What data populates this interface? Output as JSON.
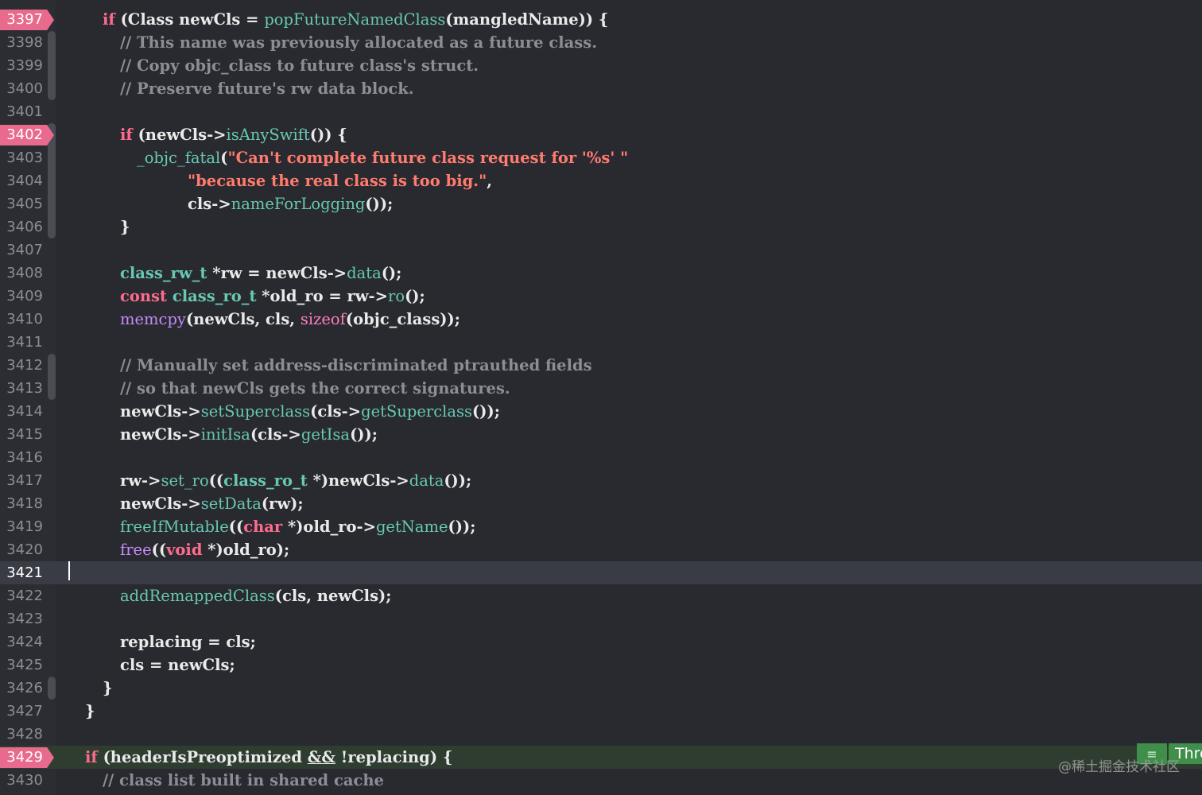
{
  "editor": {
    "current_line": "3421",
    "lines": [
      {
        "num": "3397",
        "indent": 129,
        "bp": true,
        "segs": [
          [
            "kw",
            "if"
          ],
          [
            "pl",
            " (Class newCls = "
          ],
          [
            "fn",
            "popFutureNamedClass"
          ],
          [
            "pl",
            "(mangledName)) {"
          ]
        ]
      },
      {
        "num": "3398",
        "indent": 151,
        "segs": [
          [
            "cm",
            "// This name was previously allocated as a future class."
          ]
        ]
      },
      {
        "num": "3399",
        "indent": 151,
        "segs": [
          [
            "cm",
            "// Copy objc_class to future class's struct."
          ]
        ]
      },
      {
        "num": "3400",
        "indent": 151,
        "segs": [
          [
            "cm",
            "// Preserve future's rw data block."
          ]
        ]
      },
      {
        "num": "3401",
        "indent": 151,
        "segs": []
      },
      {
        "num": "3402",
        "indent": 151,
        "bp": true,
        "segs": [
          [
            "kw",
            "if"
          ],
          [
            "pl",
            " (newCls->"
          ],
          [
            "fn",
            "isAnySwift"
          ],
          [
            "pl",
            "()) {"
          ]
        ]
      },
      {
        "num": "3403",
        "indent": 172,
        "segs": [
          [
            "fn",
            "_objc_fatal"
          ],
          [
            "pl",
            "("
          ],
          [
            "str",
            "\"Can't complete future class request for '%s' \""
          ]
        ]
      },
      {
        "num": "3404",
        "indent": 236,
        "segs": [
          [
            "str",
            "\"because the real class is too big.\""
          ],
          [
            "pl",
            ","
          ]
        ]
      },
      {
        "num": "3405",
        "indent": 236,
        "segs": [
          [
            "pl",
            "cls->"
          ],
          [
            "fn",
            "nameForLogging"
          ],
          [
            "pl",
            "());"
          ]
        ]
      },
      {
        "num": "3406",
        "indent": 151,
        "segs": [
          [
            "pl",
            "}"
          ]
        ]
      },
      {
        "num": "3407",
        "indent": 151,
        "segs": []
      },
      {
        "num": "3408",
        "indent": 151,
        "segs": [
          [
            "tp",
            "class_rw_t"
          ],
          [
            "pl",
            " *rw = newCls->"
          ],
          [
            "fn",
            "data"
          ],
          [
            "pl",
            "();"
          ]
        ]
      },
      {
        "num": "3409",
        "indent": 151,
        "segs": [
          [
            "kw",
            "const"
          ],
          [
            "pl",
            " "
          ],
          [
            "tp",
            "class_ro_t"
          ],
          [
            "pl",
            " *old_ro = rw->"
          ],
          [
            "fn",
            "ro"
          ],
          [
            "pl",
            "();"
          ]
        ]
      },
      {
        "num": "3410",
        "indent": 151,
        "segs": [
          [
            "lib",
            "memcpy"
          ],
          [
            "pl",
            "(newCls, cls, "
          ],
          [
            "mc",
            "sizeof"
          ],
          [
            "pl",
            "(objc_class));"
          ]
        ]
      },
      {
        "num": "3411",
        "indent": 151,
        "segs": []
      },
      {
        "num": "3412",
        "indent": 151,
        "segs": [
          [
            "cm",
            "// Manually set address-discriminated ptrauthed fields"
          ]
        ]
      },
      {
        "num": "3413",
        "indent": 151,
        "segs": [
          [
            "cm",
            "// so that newCls gets the correct signatures."
          ]
        ]
      },
      {
        "num": "3414",
        "indent": 151,
        "segs": [
          [
            "pl",
            "newCls->"
          ],
          [
            "fn",
            "setSuperclass"
          ],
          [
            "pl",
            "(cls->"
          ],
          [
            "fn",
            "getSuperclass"
          ],
          [
            "pl",
            "());"
          ]
        ]
      },
      {
        "num": "3415",
        "indent": 151,
        "segs": [
          [
            "pl",
            "newCls->"
          ],
          [
            "fn",
            "initIsa"
          ],
          [
            "pl",
            "(cls->"
          ],
          [
            "fn",
            "getIsa"
          ],
          [
            "pl",
            "());"
          ]
        ]
      },
      {
        "num": "3416",
        "indent": 151,
        "segs": []
      },
      {
        "num": "3417",
        "indent": 151,
        "segs": [
          [
            "pl",
            "rw->"
          ],
          [
            "fn",
            "set_ro"
          ],
          [
            "pl",
            "(("
          ],
          [
            "tp",
            "class_ro_t"
          ],
          [
            "pl",
            " *)newCls->"
          ],
          [
            "fn",
            "data"
          ],
          [
            "pl",
            "());"
          ]
        ]
      },
      {
        "num": "3418",
        "indent": 151,
        "segs": [
          [
            "pl",
            "newCls->"
          ],
          [
            "fn",
            "setData"
          ],
          [
            "pl",
            "(rw);"
          ]
        ]
      },
      {
        "num": "3419",
        "indent": 151,
        "segs": [
          [
            "fn",
            "freeIfMutable"
          ],
          [
            "pl",
            "(("
          ],
          [
            "kw",
            "char"
          ],
          [
            "pl",
            " *)old_ro->"
          ],
          [
            "fn",
            "getName"
          ],
          [
            "pl",
            "());"
          ]
        ]
      },
      {
        "num": "3420",
        "indent": 151,
        "segs": [
          [
            "lib",
            "free"
          ],
          [
            "pl",
            "(("
          ],
          [
            "kw",
            "void"
          ],
          [
            "pl",
            " *)old_ro);"
          ]
        ]
      },
      {
        "num": "3421",
        "indent": 151,
        "current": true,
        "segs": []
      },
      {
        "num": "3422",
        "indent": 151,
        "segs": [
          [
            "fn",
            "addRemappedClass"
          ],
          [
            "pl",
            "(cls, newCls);"
          ]
        ]
      },
      {
        "num": "3423",
        "indent": 151,
        "segs": []
      },
      {
        "num": "3424",
        "indent": 151,
        "segs": [
          [
            "pl",
            "replacing = cls;"
          ]
        ]
      },
      {
        "num": "3425",
        "indent": 151,
        "segs": [
          [
            "pl",
            "cls = newCls;"
          ]
        ]
      },
      {
        "num": "3426",
        "indent": 129,
        "segs": [
          [
            "pl",
            "}"
          ]
        ]
      },
      {
        "num": "3427",
        "indent": 107,
        "segs": [
          [
            "pl",
            "}"
          ]
        ]
      },
      {
        "num": "3428",
        "indent": 107,
        "segs": []
      },
      {
        "num": "3429",
        "indent": 107,
        "bp": true,
        "green": true,
        "segs": [
          [
            "kw",
            "if"
          ],
          [
            "pl",
            " (headerIsPreoptimized "
          ],
          [
            "u",
            "&&"
          ],
          [
            "pl",
            " !replacing) {"
          ]
        ]
      },
      {
        "num": "3430",
        "indent": 129,
        "segs": [
          [
            "cm",
            "// class list built in shared cache"
          ]
        ]
      }
    ]
  },
  "badge": {
    "label": "Thre",
    "icon": "list-icon",
    "glyph": "≡"
  },
  "watermark": "@稀土掘金技术社区"
}
